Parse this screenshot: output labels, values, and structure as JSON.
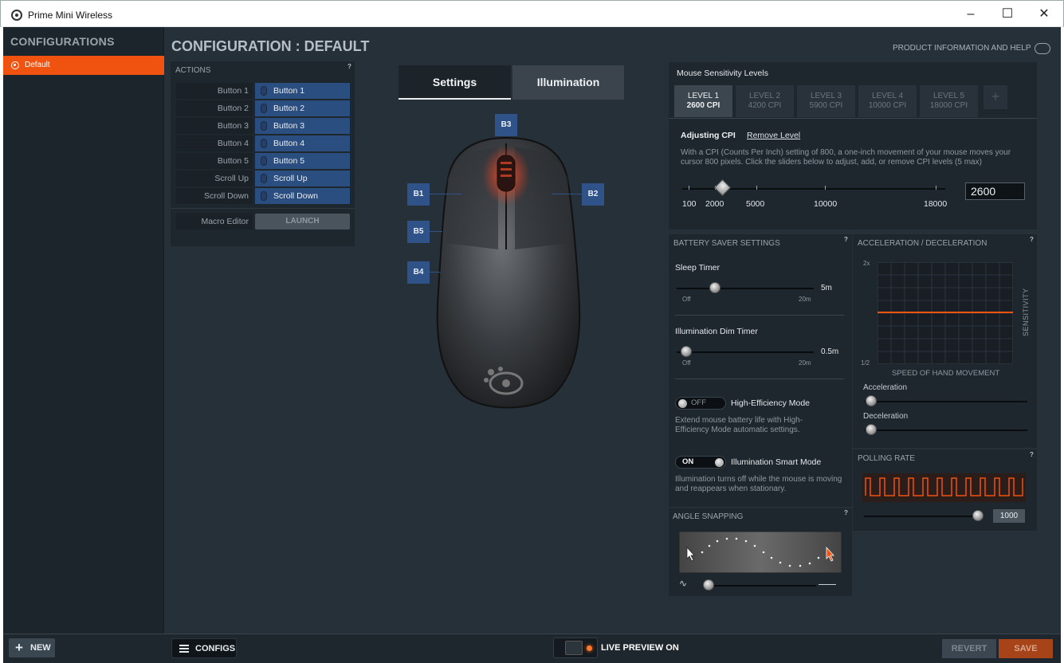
{
  "window": {
    "title": "Prime Mini Wireless"
  },
  "sidebar": {
    "title": "CONFIGURATIONS",
    "items": [
      {
        "label": "Default"
      }
    ]
  },
  "footer": {
    "new_label": "NEW",
    "configs_label": "CONFIGS",
    "live_preview_label": "LIVE PREVIEW ON",
    "revert_label": "REVERT",
    "save_label": "SAVE"
  },
  "header": {
    "title": "CONFIGURATION : DEFAULT",
    "product_info": "PRODUCT INFORMATION AND HELP"
  },
  "actions": {
    "title": "ACTIONS",
    "help": "?",
    "rows": [
      {
        "label": "Button 1",
        "value": "Button 1"
      },
      {
        "label": "Button 2",
        "value": "Button 2"
      },
      {
        "label": "Button 3",
        "value": "Button 3"
      },
      {
        "label": "Button 4",
        "value": "Button 4"
      },
      {
        "label": "Button 5",
        "value": "Button 5"
      },
      {
        "label": "Scroll Up",
        "value": "Scroll Up"
      },
      {
        "label": "Scroll Down",
        "value": "Scroll Down"
      }
    ],
    "macro_label": "Macro Editor",
    "launch_label": "LAUNCH"
  },
  "tabs": [
    {
      "label": "Settings"
    },
    {
      "label": "Illumination"
    }
  ],
  "mouse": {
    "buttons": {
      "b1": "B1",
      "b2": "B2",
      "b3": "B3",
      "b4": "B4",
      "b5": "B5"
    }
  },
  "sensitivity": {
    "title": "Mouse Sensitivity Levels",
    "levels": [
      {
        "name": "LEVEL 1",
        "cpi": "2600 CPI"
      },
      {
        "name": "LEVEL 2",
        "cpi": "4200 CPI"
      },
      {
        "name": "LEVEL 3",
        "cpi": "5900 CPI"
      },
      {
        "name": "LEVEL 4",
        "cpi": "10000 CPI"
      },
      {
        "name": "LEVEL 5",
        "cpi": "18000 CPI"
      }
    ],
    "add_label": "+",
    "adjusting_label": "Adjusting CPI",
    "remove_label": "Remove Level",
    "description": "With a CPI (Counts Per Inch) setting of 800, a one-inch movement of your mouse moves your cursor 800 pixels. Click the sliders below to adjust, add, or remove CPI levels (5 max)",
    "ticks": [
      "100",
      "2000",
      "5000",
      "10000",
      "18000"
    ],
    "value": "2600"
  },
  "battery": {
    "title": "BATTERY SAVER SETTINGS",
    "help": "?",
    "sleep_label": "Sleep Timer",
    "sleep_value": "5m",
    "sleep_min": "Off",
    "sleep_max": "20m",
    "dim_label": "Illumination Dim Timer",
    "dim_value": "0.5m",
    "dim_min": "Off",
    "dim_max": "20m",
    "hem_state": "OFF",
    "hem_label": "High-Efficiency Mode",
    "hem_desc": "Extend mouse battery life with High-Efficiency Mode automatic settings.",
    "ism_state": "ON",
    "ism_label": "Illumination Smart Mode",
    "ism_desc": "Illumination turns off while the mouse is moving and reappears when stationary."
  },
  "accel": {
    "title": "ACCELERATION / DECELERATION",
    "help": "?",
    "y_top": "2x",
    "y_bottom": "1/2",
    "y_label": "SENSITIVITY",
    "x_label": "SPEED OF HAND MOVEMENT",
    "accel_label": "Acceleration",
    "decel_label": "Deceleration"
  },
  "polling": {
    "title": "POLLING RATE",
    "help": "?",
    "value": "1000"
  },
  "angle": {
    "title": "ANGLE SNAPPING",
    "help": "?"
  },
  "colors": {
    "accent": "#f0520f",
    "button_blue": "#2b4e80",
    "panel": "#1f272e",
    "background": "#263038"
  }
}
